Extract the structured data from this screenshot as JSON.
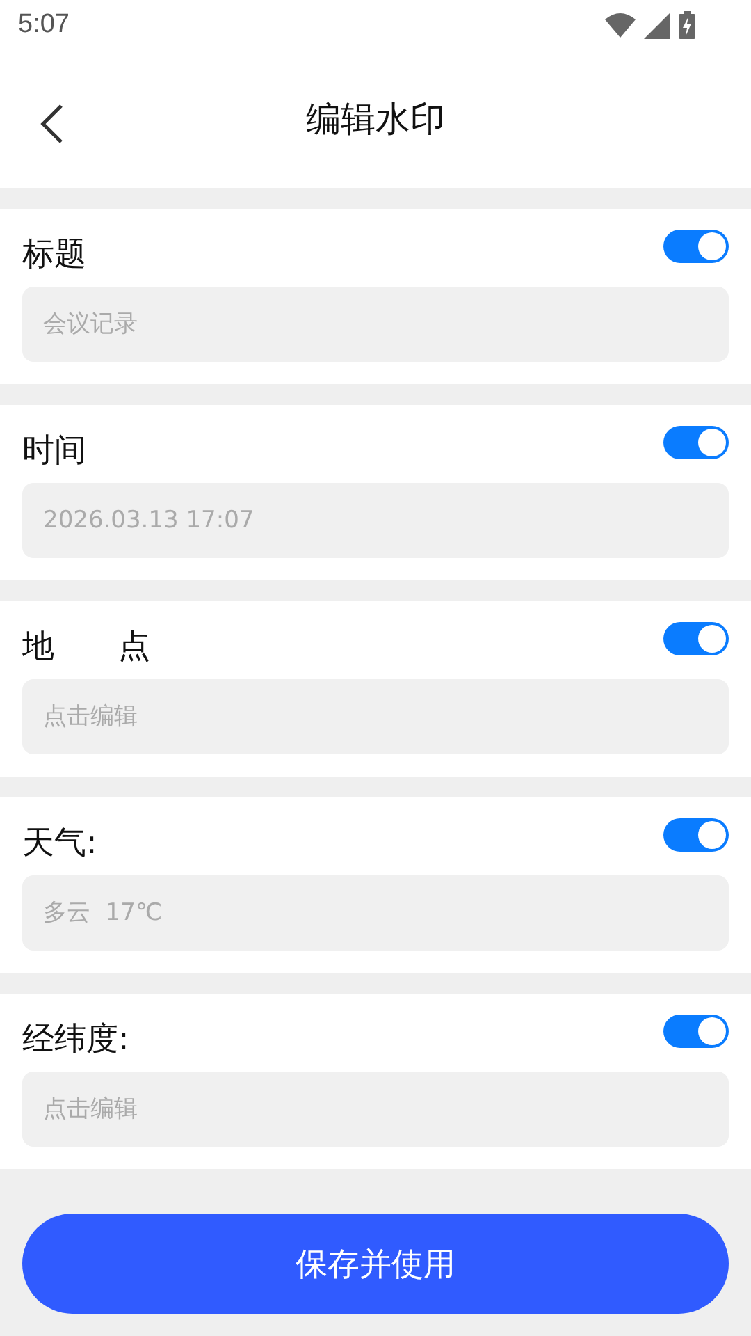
{
  "status_bar": {
    "time": "5:07"
  },
  "header": {
    "title": "编辑水印"
  },
  "fields": [
    {
      "label": "标题",
      "on": true,
      "placeholder": "会议记录"
    },
    {
      "label": "时间",
      "on": true,
      "placeholder": "2026.03.13 17:07"
    },
    {
      "label": "地　　点",
      "on": true,
      "placeholder": "点击编辑"
    },
    {
      "label": "天气:",
      "on": true,
      "placeholder": "多云  17℃"
    },
    {
      "label": "经纬度:",
      "on": true,
      "placeholder": "点击编辑"
    }
  ],
  "save_button": "保存并使用"
}
